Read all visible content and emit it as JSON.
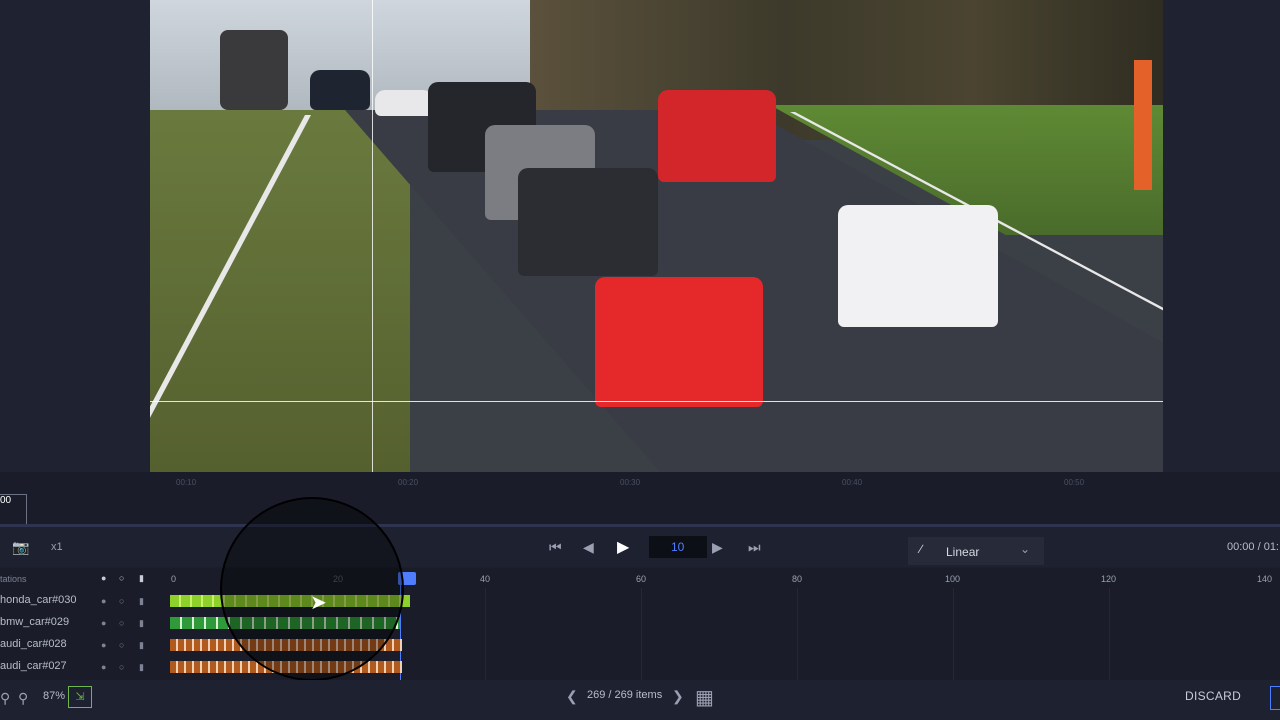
{
  "ruler": {
    "ticks": [
      "00:10",
      "00:20",
      "00:30",
      "00:40",
      "00:50"
    ],
    "zoom_value": "00"
  },
  "controls": {
    "speed": "x1",
    "frame_value": "10",
    "interpolation": "Linear",
    "timecode": "00:00 / 01:"
  },
  "timeline": {
    "header_label": "tations",
    "axis": [
      "0",
      "20",
      "40",
      "60",
      "80",
      "100",
      "120",
      "140"
    ],
    "tracks": [
      {
        "label": "honda_car#030",
        "color": "#8fd12b"
      },
      {
        "label": "bmw_car#029",
        "color": "#2f9a3a"
      },
      {
        "label": "audi_car#028",
        "color": "#b15a1e"
      },
      {
        "label": "audi_car#027",
        "color": "#b15a1e"
      }
    ]
  },
  "bottom": {
    "zoom_level": "87%",
    "items_text": "269 / 269 items",
    "discard_label": "DISCARD"
  },
  "icons": {
    "camera": "camera-icon",
    "first_frame": "skip-to-start-icon",
    "prev_frame": "step-back-icon",
    "play": "play-icon",
    "next_frame": "step-forward-icon",
    "last_frame": "skip-to-end-icon",
    "interp": "slash-icon",
    "dropdown": "chevron-down-icon",
    "zoom_out": "zoom-out-icon",
    "zoom_in": "zoom-in-icon",
    "fit": "fit-screen-icon",
    "prev_item": "chevron-left-icon",
    "next_item": "chevron-right-icon",
    "grid": "grid-view-icon"
  },
  "colors": {
    "accent": "#4f7dff",
    "background": "#1b1e2b"
  }
}
